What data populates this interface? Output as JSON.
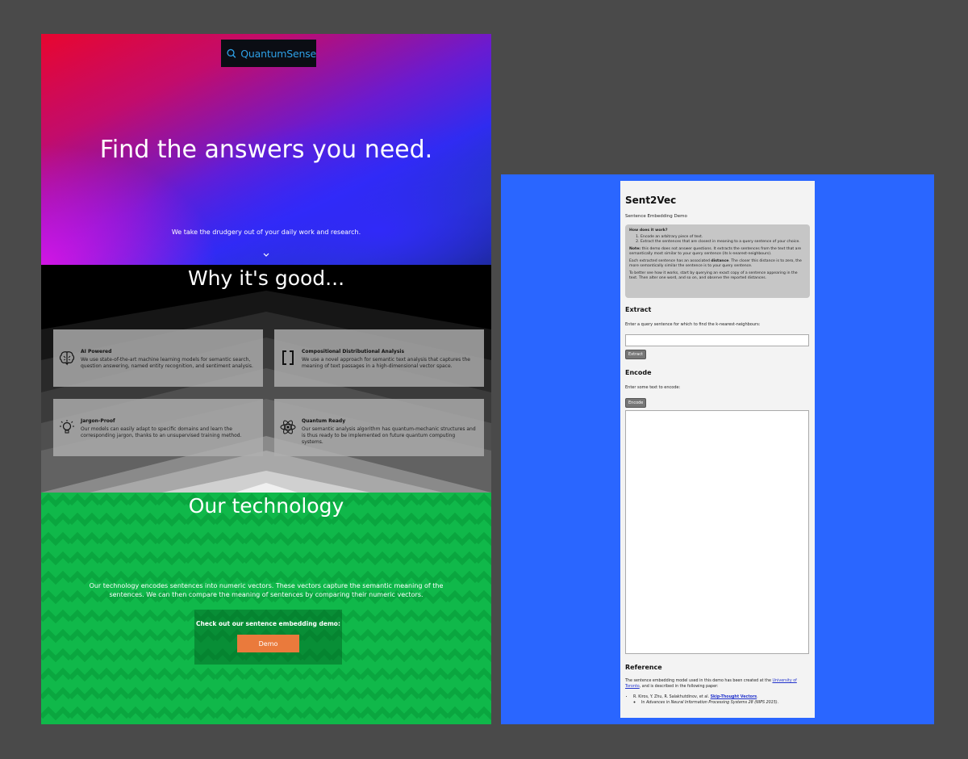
{
  "landing": {
    "logo_text": "QuantumSense",
    "hero": {
      "title": "Find the answers you need.",
      "subtitle": "We take the drudgery out of your daily work and research."
    },
    "why": {
      "title": "Why it's good...",
      "features": [
        {
          "icon": "brain-icon",
          "title": "AI Powered",
          "desc": "We use state-of-the-art machine learning models for semantic search, question answering, named entity recognition, and sentiment analysis."
        },
        {
          "icon": "brackets-icon",
          "title": "Compositional Distributional Analysis",
          "desc": "We use a novel approach for semantic text analysis that captures the meaning of text passages in a high-dimensional vector space."
        },
        {
          "icon": "lightbulb-icon",
          "title": "Jargon-Proof",
          "desc": "Our models can easily adapt to specific domains and learn the corresponding jargon, thanks to an unsupervised training method."
        },
        {
          "icon": "atom-icon",
          "title": "Quantum Ready",
          "desc": "Our semantic analysis algorithm has quantum-mechanic structures and is thus ready to be implemented on future quantum computing systems."
        }
      ]
    },
    "technology": {
      "title": "Our technology",
      "text": "Our technology encodes sentences into numeric vectors. These vectors capture the semantic meaning of the sentences. We can then compare the meaning of sentences by comparing their numeric vectors.",
      "demo_box_title": "Check out our sentence embedding demo:",
      "demo_button": "Demo"
    },
    "colors": {
      "accent_orange": "#ea7a3c",
      "tech_green": "#10b84a",
      "logo_blue": "#2ea0e6"
    }
  },
  "sent2vec": {
    "title": "Sent2Vec",
    "subtitle": "Sentence Embedding Demo",
    "how": {
      "title": "How does it work?",
      "steps": [
        "Encode an arbitrary piece of text.",
        "Extract the sentences that are closest in meaning to a query sentence of your choice."
      ],
      "note_label": "Note:",
      "note_text": " this demo does not answer questions. It extracts the sentences from the text that are semantically most similar to your query sentence (its k-nearest-neighbours).",
      "distance_pre": "Each extracted sentence has an associated ",
      "distance_word": "distance",
      "distance_post": ". The closer this distance is to zero, the more semantically similar the sentence is to your query sentence.",
      "tip": "To better see how it works, start by querying an exact copy of a sentence appearing in the text. Then alter one word, and so on, and observe the reported distances."
    },
    "extract": {
      "heading": "Extract",
      "label": "Enter a query sentence for which to find the k-nearest-neighbours:",
      "input_value": "",
      "button": "Extract"
    },
    "encode": {
      "heading": "Encode",
      "label": "Enter some text to encode:",
      "button": "Encode",
      "textarea_value": ""
    },
    "reference": {
      "heading": "Reference",
      "text_pre": "The sentence embedding model used in this demo has been created at the ",
      "link": "University of Toronto",
      "text_post": ", and is described in the following paper:",
      "authors": "R. Kiros, Y. Zhu, R. Salakhutdinov, et al. ",
      "paper_link": "Skip-Thought Vectors",
      "paper_end": ".",
      "venue_pre": "In ",
      "venue": "Advances in Neural Information Processing Systems 28 (NIPS 2015)",
      "venue_end": "."
    },
    "colors": {
      "background": "#2a66ff",
      "card": "#f3f3f3",
      "how_box": "#c6c6c6"
    }
  }
}
